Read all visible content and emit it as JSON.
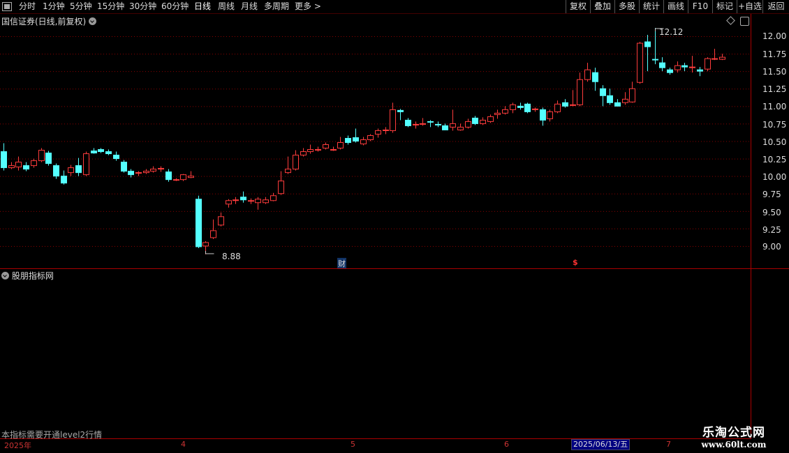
{
  "toolbar": {
    "periods": [
      "分时",
      "1分钟",
      "5分钟",
      "15分钟",
      "30分钟",
      "60分钟",
      "日线",
      "周线",
      "月线",
      "多周期",
      "更多 >"
    ],
    "active_period": "日线",
    "buttons": [
      "复权",
      "叠加",
      "多股",
      "统计",
      "画线",
      "F10",
      "标记",
      "+自选",
      "返回"
    ]
  },
  "main_chart": {
    "title": "国信证券(日线,前复权)",
    "price_labels": [
      "12.00",
      "11.75",
      "11.50",
      "11.25",
      "11.00",
      "10.75",
      "10.50",
      "10.25",
      "10.00",
      "9.75",
      "9.50",
      "9.25",
      "9.00"
    ],
    "high_annotation": "12.12",
    "low_annotation": "8.88",
    "event_marker_cai": "财",
    "event_marker_s": "$"
  },
  "indicator": {
    "title": "股朋指标网",
    "notice": "本指标需要开通level2行情"
  },
  "date_axis": {
    "labels": [
      "2025年",
      "4",
      "5",
      "6",
      "7"
    ],
    "highlighted_date": "2025/06/13/五"
  },
  "watermark": {
    "title": "乐淘公式网",
    "url": "www.60lt.com"
  },
  "colors": {
    "up": "#ff3c3c",
    "down": "#54ffff",
    "grid": "#8b0000",
    "axis": "#a00000"
  },
  "chart_data": {
    "type": "candlestick",
    "ylim": [
      8.8,
      12.2
    ],
    "candles": [
      [
        10.35,
        10.12,
        10.47,
        10.08
      ],
      [
        10.12,
        10.15,
        10.2,
        10.1
      ],
      [
        10.13,
        10.2,
        10.28,
        10.08
      ],
      [
        10.15,
        10.1,
        10.2,
        10.07
      ],
      [
        10.15,
        10.22,
        10.25,
        10.12
      ],
      [
        10.22,
        10.37,
        10.4,
        10.2
      ],
      [
        10.33,
        10.18,
        10.36,
        10.15
      ],
      [
        10.15,
        10.0,
        10.18,
        9.96
      ],
      [
        10.0,
        9.9,
        10.08,
        9.88
      ],
      [
        10.05,
        10.12,
        10.16,
        10.0
      ],
      [
        10.15,
        10.05,
        10.26,
        10.0
      ],
      [
        10.02,
        10.32,
        10.35,
        10.0
      ],
      [
        10.36,
        10.33,
        10.4,
        10.32
      ],
      [
        10.38,
        10.35,
        10.4,
        10.33
      ],
      [
        10.35,
        10.32,
        10.38,
        10.3
      ],
      [
        10.3,
        10.25,
        10.35,
        10.22
      ],
      [
        10.2,
        10.07,
        10.23,
        10.05
      ],
      [
        10.07,
        10.02,
        10.1,
        9.98
      ],
      [
        10.04,
        10.05,
        10.07,
        10.0
      ],
      [
        10.05,
        10.07,
        10.1,
        10.03
      ],
      [
        10.07,
        10.1,
        10.14,
        10.05
      ],
      [
        10.1,
        10.11,
        10.14,
        10.06
      ],
      [
        10.06,
        9.95,
        10.1,
        9.92
      ],
      [
        9.95,
        9.95,
        9.97,
        9.93
      ],
      [
        9.95,
        10.02,
        10.03,
        9.93
      ],
      [
        9.98,
        10.0,
        10.07,
        9.97
      ],
      [
        9.67,
        8.99,
        9.72,
        8.97
      ],
      [
        9.0,
        9.05,
        9.07,
        8.88
      ],
      [
        9.12,
        9.22,
        9.38,
        9.1
      ],
      [
        9.3,
        9.42,
        9.48,
        9.28
      ],
      [
        9.6,
        9.65,
        9.67,
        9.55
      ],
      [
        9.65,
        9.66,
        9.7,
        9.6
      ],
      [
        9.7,
        9.66,
        9.78,
        9.62
      ],
      [
        9.65,
        9.65,
        9.68,
        9.6
      ],
      [
        9.62,
        9.67,
        9.7,
        9.52
      ],
      [
        9.62,
        9.66,
        9.7,
        9.6
      ],
      [
        9.65,
        9.72,
        9.76,
        9.64
      ],
      [
        9.75,
        9.93,
        10.07,
        9.73
      ],
      [
        10.05,
        10.1,
        10.28,
        10.03
      ],
      [
        10.1,
        10.3,
        10.37,
        10.08
      ],
      [
        10.3,
        10.35,
        10.4,
        10.28
      ],
      [
        10.35,
        10.38,
        10.45,
        10.32
      ],
      [
        10.38,
        10.38,
        10.42,
        10.35
      ],
      [
        10.4,
        10.45,
        10.48,
        10.38
      ],
      [
        10.38,
        10.38,
        10.42,
        10.36
      ],
      [
        10.4,
        10.48,
        10.56,
        10.38
      ],
      [
        10.54,
        10.48,
        10.58,
        10.45
      ],
      [
        10.55,
        10.5,
        10.68,
        10.48
      ],
      [
        10.46,
        10.52,
        10.56,
        10.44
      ],
      [
        10.52,
        10.58,
        10.6,
        10.5
      ],
      [
        10.6,
        10.65,
        10.68,
        10.55
      ],
      [
        10.65,
        10.66,
        10.7,
        10.6
      ],
      [
        10.65,
        10.95,
        11.05,
        10.62
      ],
      [
        10.94,
        10.92,
        10.96,
        10.8
      ],
      [
        10.8,
        10.72,
        10.83,
        10.7
      ],
      [
        10.73,
        10.74,
        10.78,
        10.68
      ],
      [
        10.75,
        10.75,
        10.83,
        10.72
      ],
      [
        10.78,
        10.77,
        10.8,
        10.7
      ],
      [
        10.74,
        10.73,
        10.78,
        10.7
      ],
      [
        10.72,
        10.66,
        10.75,
        10.66
      ],
      [
        10.7,
        10.75,
        10.95,
        10.65
      ],
      [
        10.66,
        10.7,
        10.75,
        10.65
      ],
      [
        10.7,
        10.78,
        10.82,
        10.68
      ],
      [
        10.83,
        10.75,
        10.86,
        10.73
      ],
      [
        10.75,
        10.8,
        10.84,
        10.73
      ],
      [
        10.78,
        10.85,
        10.88,
        10.76
      ],
      [
        10.88,
        10.9,
        10.95,
        10.82
      ],
      [
        10.9,
        10.95,
        11.0,
        10.88
      ],
      [
        10.95,
        11.02,
        11.05,
        10.9
      ],
      [
        11.0,
        10.98,
        11.05,
        10.95
      ],
      [
        11.03,
        10.92,
        11.05,
        10.9
      ],
      [
        10.95,
        10.96,
        10.98,
        10.92
      ],
      [
        10.95,
        10.8,
        10.98,
        10.72
      ],
      [
        10.82,
        10.92,
        10.95,
        10.78
      ],
      [
        10.92,
        11.03,
        11.08,
        10.9
      ],
      [
        11.05,
        11.0,
        11.1,
        10.98
      ],
      [
        11.02,
        11.02,
        11.23,
        11.0
      ],
      [
        11.02,
        11.38,
        11.48,
        11.0
      ],
      [
        11.38,
        11.52,
        11.62,
        11.35
      ],
      [
        11.48,
        11.35,
        11.55,
        11.22
      ],
      [
        11.25,
        11.15,
        11.3,
        11.0
      ],
      [
        11.15,
        11.05,
        11.25,
        11.02
      ],
      [
        11.05,
        11.0,
        11.1,
        11.0
      ],
      [
        11.05,
        11.1,
        11.2,
        11.02
      ],
      [
        11.06,
        11.25,
        11.35,
        11.05
      ],
      [
        11.34,
        11.9,
        11.92,
        11.32
      ],
      [
        11.92,
        11.85,
        12.02,
        11.5
      ],
      [
        11.67,
        11.66,
        12.12,
        11.6
      ],
      [
        11.62,
        11.55,
        11.7,
        11.5
      ],
      [
        11.52,
        11.48,
        11.55,
        11.45
      ],
      [
        11.52,
        11.58,
        11.64,
        11.48
      ],
      [
        11.58,
        11.56,
        11.62,
        11.5
      ],
      [
        11.56,
        11.56,
        11.72,
        11.48
      ],
      [
        11.52,
        11.5,
        11.56,
        11.43
      ],
      [
        11.53,
        11.68,
        11.7,
        11.5
      ],
      [
        11.67,
        11.68,
        11.82,
        11.66
      ],
      [
        11.67,
        11.7,
        11.75,
        11.66
      ]
    ]
  }
}
